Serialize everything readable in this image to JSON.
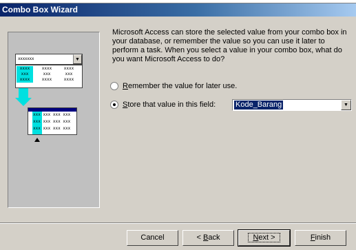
{
  "window": {
    "title": "Combo Box Wizard"
  },
  "illustration": {
    "combo_text": "xxxxxxx",
    "list_col1": [
      "xxxx",
      "xxx",
      "xxxx"
    ],
    "list_col2": [
      "xxxx",
      "xxx",
      "xxxx"
    ],
    "list_col3": [
      "xxxx",
      "xxx",
      "xxxx"
    ],
    "table_rows": [
      "xxx xxx xxx xxx",
      "xxx xxx xxx xxx",
      "xxx xxx xxx xxx"
    ]
  },
  "description": "Microsoft Access can store the selected value from your combo box in your database, or remember the value so you can use it later to perform a task.  When you select a value in your combo box, what do you want Microsoft Access to do?",
  "options": {
    "remember": {
      "accel": "R",
      "rest": "emember the value for later use.",
      "checked": false
    },
    "store": {
      "accel": "S",
      "rest": "tore that value in this field:",
      "checked": true
    }
  },
  "field_select": {
    "value": "Kode_Barang"
  },
  "buttons": {
    "cancel": "Cancel",
    "back_prefix": "< ",
    "back_accel": "B",
    "back_rest": "ack",
    "next_accel": "N",
    "next_rest": "ext >",
    "finish_accel": "F",
    "finish_rest": "inish"
  }
}
